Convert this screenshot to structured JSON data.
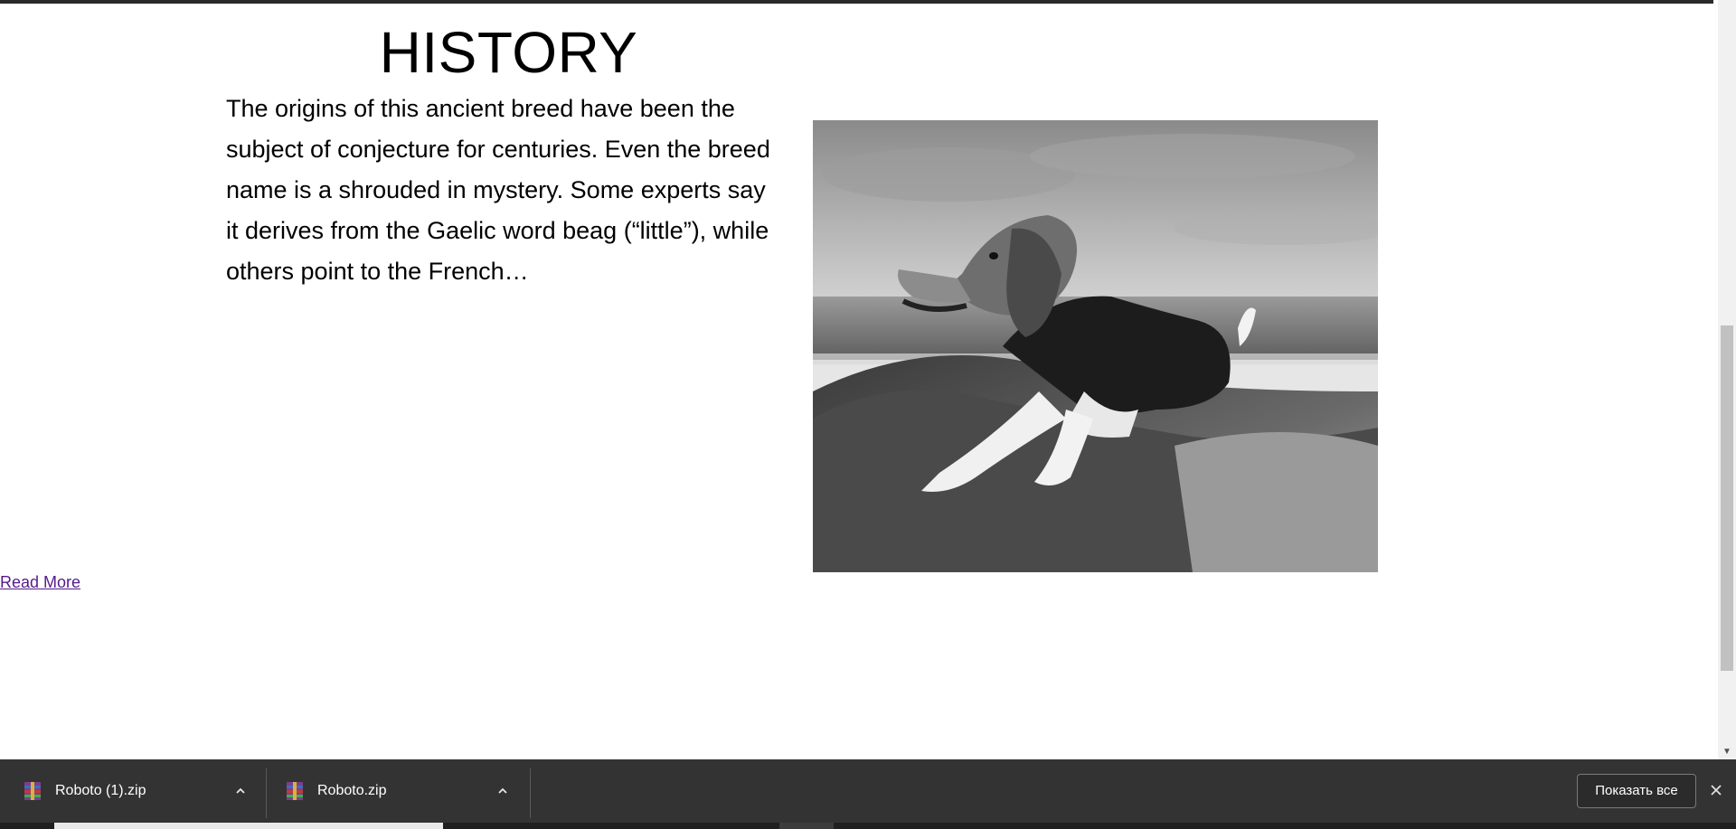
{
  "section": {
    "title": "HISTORY",
    "paragraph": "The origins of this ancient breed have been the subject of conjecture for centuries. Even the breed name is a shrouded in mystery. Some experts say it derives from the Gaelic word beag (“little”), while others point to the French…",
    "read_more_label": "Read More"
  },
  "colors": {
    "link": "#551a8b",
    "download_bar": "#333333"
  },
  "downloads": {
    "items": [
      {
        "name": "Roboto (1).zip",
        "icon": "winrar-archive-icon"
      },
      {
        "name": "Roboto.zip",
        "icon": "winrar-archive-icon"
      }
    ],
    "show_all_label": "Показать все",
    "close_icon": "close-icon"
  }
}
